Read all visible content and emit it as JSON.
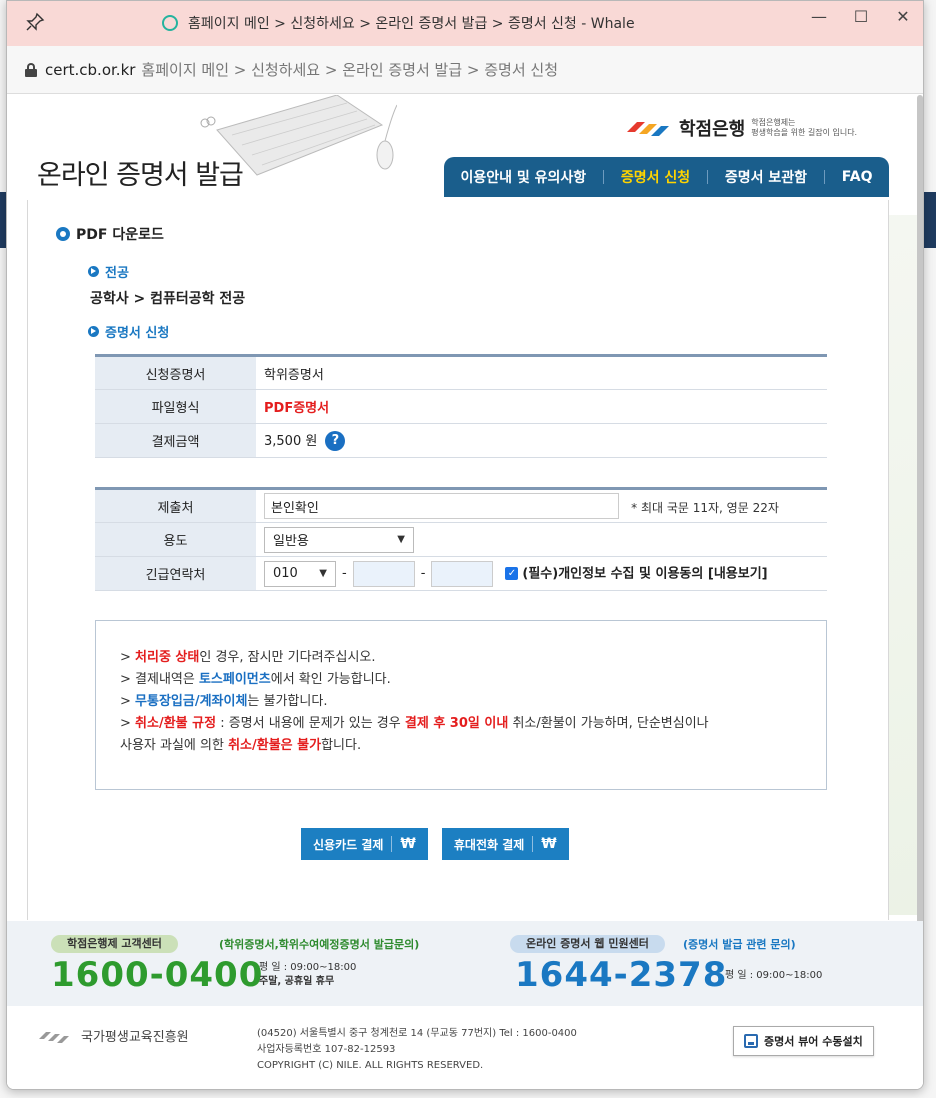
{
  "window": {
    "title": "홈페이지 메인 > 신청하세요 > 온라인 증명서 발급 > 증명서 신청 - Whale",
    "controls": [
      "—",
      "☐",
      "✕"
    ]
  },
  "address": {
    "domain": "cert.cb.or.kr",
    "path": "홈페이지 메인 > 신청하세요 > 온라인 증명서 발급 > 증명서 신청"
  },
  "header": {
    "page_title": "온라인 증명서 발급",
    "logo_text": "학점은행",
    "logo_sub_1": "학점은행제는",
    "logo_sub_2": "평생학습을 위한 길잡이 입니다.",
    "nav": [
      {
        "label": "이용안내 및 유의사항"
      },
      {
        "label": "증명서 신청"
      },
      {
        "label": "증명서 보관함"
      },
      {
        "label": "FAQ"
      }
    ]
  },
  "section": {
    "pdf_title": "PDF 다운로드",
    "major_label": "전공",
    "major_value": "공학사 > 컴퓨터공학 전공",
    "apply_label": "증명서 신청"
  },
  "table1": {
    "rows": [
      {
        "label": "신청증명서",
        "value": "학위증명서"
      },
      {
        "label": "파일형식",
        "value": "PDF증명서"
      },
      {
        "label": "결제금액",
        "value": "3,500 원"
      }
    ],
    "help": "?"
  },
  "table2": {
    "submit_label": "제출처",
    "submit_value": "본인확인",
    "submit_hint": "* 최대 국문 11자, 영문 22자",
    "use_label": "용도",
    "use_value": "일반용",
    "phone_label": "긴급연락처",
    "phone_prefix": "010",
    "dash": "-",
    "agree_text": "(필수)개인정보 수집 및 이용동의 [내용보기]"
  },
  "notice": {
    "line1_pre": "> ",
    "line1_red": "처리중 상태",
    "line1_post": "인 경우, 잠시만 기다려주십시오.",
    "line2_pre": "> 결제내역은 ",
    "line2_blue": "토스페이먼츠",
    "line2_post": "에서 확인 가능합니다.",
    "line3_pre": "> ",
    "line3_blue": "무통장입금/계좌이체",
    "line3_post": "는 불가합니다.",
    "line4_pre": "> ",
    "line4_red1": "취소/환불 규정",
    "line4_mid1": " : 증명서 내용에 문제가 있는 경우 ",
    "line4_red2": "결제 후 30일 이내",
    "line4_mid2": " 취소/환불이 가능하며, 단순변심이나",
    "line5_pre": "사용자 과실에 의한 ",
    "line5_red": "취소/환불은 불가",
    "line5_post": "합니다."
  },
  "buttons": {
    "card": "신용카드 결제",
    "phone": "휴대전화 결제",
    "won": "₩"
  },
  "footer": {
    "center1_label": "학점은행제 고객센터",
    "center1_note": "(학위증명서,학위수여예정증명서 발급문의)",
    "center1_number": "1600-0400",
    "center1_hours1": "평   일 : 09:00~18:00",
    "center1_hours2": "주말, 공휴일 휴무",
    "center2_label": "온라인 증명서 웹 민원센터",
    "center2_note": "(증명서 발급 관련 문의)",
    "center2_number": "1644-2378",
    "center2_hours": "평   일 : 09:00~18:00",
    "org_name": "국가평생교육진흥원",
    "address1": "(04520) 서울특별시 중구 청계천로 14 (무교동 77번지)   Tel : 1600-0400",
    "address2": "사업자등록번호 107-82-12593",
    "address3": "COPYRIGHT (C) NILE. ALL RIGHTS RESERVED.",
    "viewer_btn": "증명서 뷰어 수동설치"
  },
  "colors": {
    "nav_bg": "#1a5e8c",
    "accent_blue": "#1a78c2",
    "red": "#e41d1d",
    "green_number": "#2e9b2e",
    "blue_number": "#1a78c2"
  }
}
